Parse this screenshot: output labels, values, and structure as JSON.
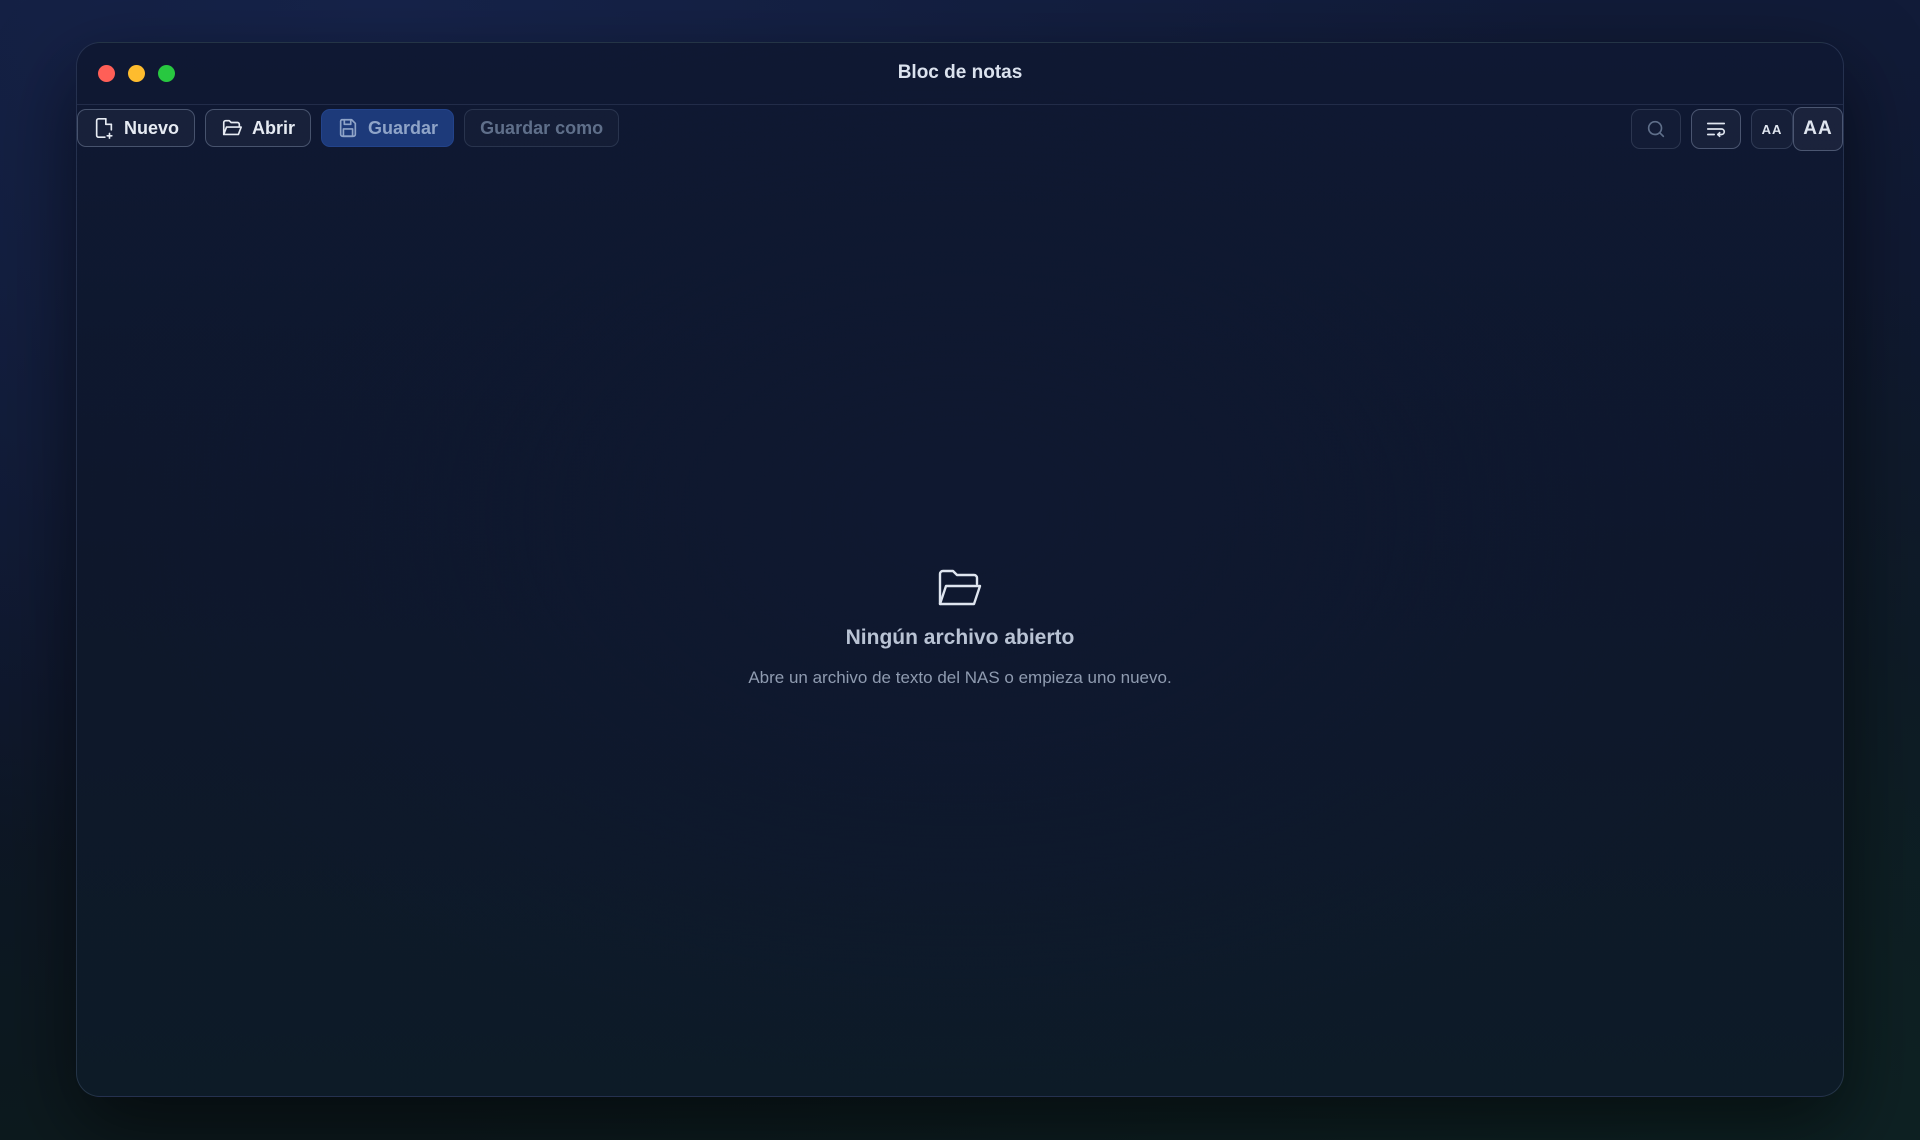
{
  "window": {
    "title": "Bloc de notas"
  },
  "toolbar": {
    "new_label": "Nuevo",
    "open_label": "Abrir",
    "save_label": "Guardar",
    "save_as_label": "Guardar como",
    "font_small_label": "AA",
    "font_large_label": "AA"
  },
  "empty_state": {
    "title": "Ningún archivo abierto",
    "subtitle": "Abre un archivo de texto del NAS o empieza uno nuevo."
  },
  "icons": {
    "new": "file-plus-icon",
    "open": "folder-open-icon",
    "save": "save-icon",
    "search": "search-icon",
    "wrap": "word-wrap-icon",
    "empty": "folder-open-icon"
  },
  "colors": {
    "close": "#ff5f57",
    "minimize": "#febc2e",
    "maximize": "#28c840",
    "primary": "#1d3a7a"
  }
}
